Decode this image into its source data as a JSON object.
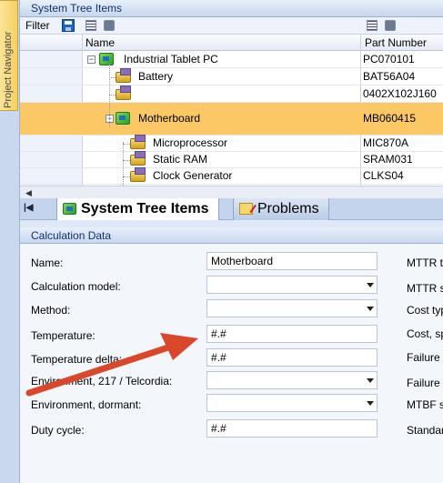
{
  "navigator": {
    "tab_label": "Project Navigator"
  },
  "tree_panel": {
    "title": "System Tree Items",
    "filter_label": "Filter",
    "columns": {
      "name": "Name",
      "part_number": "Part Number"
    },
    "rows": [
      {
        "name": "Industrial Tablet PC",
        "part_number": "PC070101",
        "level": 0,
        "icon": "assembly-icon",
        "expanded": true
      },
      {
        "name": "Battery",
        "part_number": "BAT56A04",
        "level": 1,
        "icon": "part-icon"
      },
      {
        "name": "",
        "part_number": "0402X102J160",
        "level": 1,
        "icon": "part-icon"
      },
      {
        "name": "Motherboard",
        "part_number": "MB060415",
        "level": 1,
        "icon": "assembly-icon",
        "expanded": true,
        "selected": true
      },
      {
        "name": "Microprocessor",
        "part_number": "MIC870A",
        "level": 2,
        "icon": "part-icon"
      },
      {
        "name": "Static RAM",
        "part_number": "SRAM031",
        "level": 2,
        "icon": "part-icon"
      },
      {
        "name": "Clock Generator",
        "part_number": "CLKS04",
        "level": 2,
        "icon": "part-icon"
      }
    ]
  },
  "tabs": [
    {
      "label": "System Tree Items",
      "active": true,
      "icon": "system-tree-icon"
    },
    {
      "label": "Problems",
      "active": false,
      "icon": "problems-icon"
    }
  ],
  "calc_panel": {
    "title": "Calculation Data",
    "fields": [
      {
        "label": "Name:",
        "value": "Motherboard",
        "type": "text"
      },
      {
        "label": "Calculation model:",
        "value": "",
        "type": "select"
      },
      {
        "label": "Method:",
        "value": "",
        "type": "select"
      },
      {
        "label": "Temperature:",
        "value": "#.#",
        "type": "text"
      },
      {
        "label": "Temperature delta:",
        "value": "#.#",
        "type": "text"
      },
      {
        "label": "Environment, 217 / Telcordia:",
        "value": "",
        "type": "select"
      },
      {
        "label": "Environment, dormant:",
        "value": "",
        "type": "select"
      },
      {
        "label": "Duty cycle:",
        "value": "#.#",
        "type": "text"
      }
    ],
    "right_labels": [
      "MTTR ty",
      "MTTR sp",
      "Cost typ",
      "Cost, sp",
      "Failure r",
      "Failure r",
      "MTBF sp",
      "Standar"
    ]
  },
  "colors": {
    "selected_row": "#fcc865",
    "annotation_arrow": "#d9482b"
  }
}
